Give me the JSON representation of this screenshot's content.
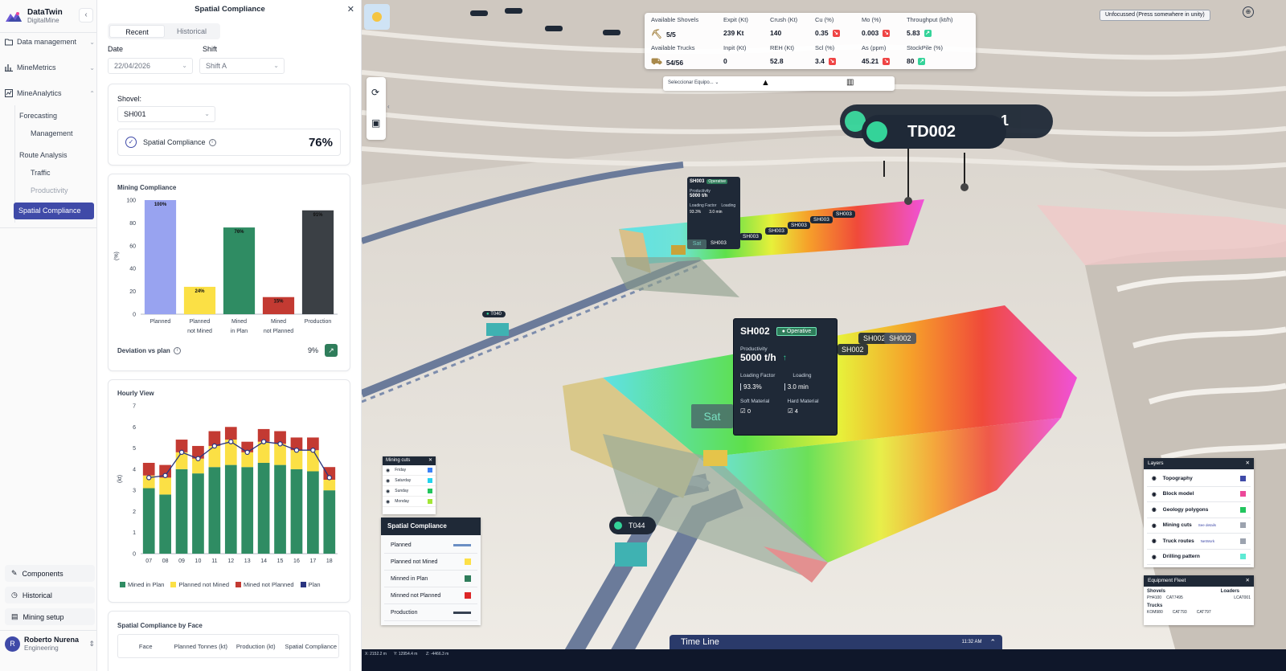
{
  "brand": {
    "name": "DataTwin",
    "sub": "DigitalMine"
  },
  "sidebar": {
    "data_management": "Data management",
    "mine_metrics": "MineMetrics",
    "mine_analytics": "MineAnalytics",
    "forecasting": "Forecasting",
    "management": "Management",
    "route_analysis": "Route Analysis",
    "traffic": "Traffic",
    "productivity": "Productivity",
    "spatial_compliance": "Spatial Compliance",
    "components": "Components",
    "historical": "Historical",
    "mining_setup": "Mining setup",
    "user_initial": "R",
    "user_name": "Roberto Nurena",
    "user_role": "Engineering"
  },
  "panel": {
    "title": "Spatial Compliance",
    "tabs": [
      "Recent",
      "Historical"
    ],
    "date_label": "Date",
    "date_value": "22/04/2026",
    "shift_label": "Shift",
    "shift_value": "Shift A",
    "shovel_label": "Shovel:",
    "shovel_value": "SH001",
    "kpi_label": "Spatial Compliance",
    "kpi_value": "76%",
    "mining_compliance_title": "Mining Compliance",
    "deviation_label": "Deviation vs plan",
    "deviation_value": "9%",
    "hourly_title": "Hourly View",
    "by_face_title": "Spatial Compliance by Face",
    "table_headers": [
      "Face",
      "Planned Tonnes (kt)",
      "Production (kt)",
      "Spatial Compliance"
    ]
  },
  "chart_data": [
    {
      "type": "bar",
      "title": "Mining Compliance",
      "ylabel": "(%)",
      "ylim": [
        0,
        100
      ],
      "yticks": [
        0,
        20,
        40,
        60,
        80,
        100
      ],
      "categories": [
        "Planned",
        "Planned not Mined",
        "Mined in Plan",
        "Mined not Planned",
        "Production"
      ],
      "category_lines": [
        [
          "Planned"
        ],
        [
          "Planned",
          "not Mined"
        ],
        [
          "Mined",
          "in Plan"
        ],
        [
          "Mined",
          "not Planned"
        ],
        [
          "Production"
        ]
      ],
      "values": [
        100,
        24,
        76,
        15,
        91
      ],
      "labels": [
        "100%",
        "24%",
        "76%",
        "15%",
        "91%"
      ],
      "colors": [
        "#98a3f0",
        "#fbe045",
        "#2f8c63",
        "#c33a32",
        "#3b4045"
      ]
    },
    {
      "type": "bar",
      "title": "Hourly View",
      "ylabel": "(kt)",
      "ylim": [
        0,
        7
      ],
      "yticks": [
        0,
        1,
        2,
        3,
        4,
        5,
        6,
        7
      ],
      "categories": [
        "07",
        "08",
        "09",
        "10",
        "11",
        "12",
        "13",
        "14",
        "15",
        "16",
        "17",
        "18"
      ],
      "series": [
        {
          "name": "Mined in Plan",
          "type": "bar",
          "color": "#2f8c63",
          "values": [
            3.1,
            2.8,
            4.0,
            3.8,
            4.1,
            4.2,
            4.1,
            4.3,
            4.2,
            4.0,
            3.9,
            3.0
          ]
        },
        {
          "name": "Planned not Mined",
          "type": "bar",
          "color": "#fbe045",
          "values": [
            0.6,
            0.8,
            0.8,
            0.7,
            1.0,
            1.2,
            0.7,
            1.0,
            1.0,
            0.9,
            1.0,
            0.5
          ]
        },
        {
          "name": "Mined not Planned",
          "type": "bar",
          "color": "#c33a32",
          "values": [
            0.6,
            0.6,
            0.6,
            0.6,
            0.7,
            0.6,
            0.5,
            0.6,
            0.6,
            0.6,
            0.6,
            0.6
          ]
        },
        {
          "name": "Plan",
          "type": "line",
          "color": "#2a3580",
          "values": [
            3.6,
            3.7,
            4.8,
            4.5,
            5.1,
            5.3,
            4.8,
            5.3,
            5.2,
            4.9,
            4.9,
            3.6
          ]
        }
      ]
    }
  ],
  "metrics": [
    {
      "label": "Available Shovels",
      "value": "5/5",
      "icon": "shovel-icon"
    },
    {
      "label": "Expit (Kt)",
      "value": "239 Kt"
    },
    {
      "label": "Crush (Kt)",
      "value": "140"
    },
    {
      "label": "Cu (%)",
      "value": "0.35",
      "trend": "down"
    },
    {
      "label": "Mo (%)",
      "value": "0.003",
      "trend": "down"
    },
    {
      "label": "Throughput (kt/h)",
      "value": "5.83",
      "trend": "up"
    },
    {
      "label": "Available Trucks",
      "value": "54/56",
      "icon": "truck-icon"
    },
    {
      "label": "Inpit (Kt)",
      "value": "0"
    },
    {
      "label": "REH (Kt)",
      "value": "52.8"
    },
    {
      "label": "Scl (%)",
      "value": "3.4",
      "trend": "down"
    },
    {
      "label": "As (ppm)",
      "value": "45.21",
      "trend": "down"
    },
    {
      "label": "StockPile (%)",
      "value": "80",
      "trend": "up"
    }
  ],
  "scene": {
    "equip_select": "Seleccionar Equipo...",
    "unfocused": "Unfocussed (Press somewhere in unity)",
    "td_tag": "TD002",
    "td_tag_partial": "1",
    "sh002_popup": {
      "id": "SH002",
      "status": "Operative",
      "productivity_label": "Productivity",
      "productivity": "5000 t/h",
      "loading_factor_label": "Loading Factor",
      "loading_factor": "93.3%",
      "loading_label": "Loading",
      "loading": "3.0 min",
      "soft_label": "Soft Material",
      "soft_value": "0",
      "hard_label": "Hard Material",
      "hard_value": "4"
    },
    "sh003_popup": {
      "id": "SH003",
      "status": "Operative",
      "productivity_label": "Productivity",
      "productivity": "5000 t/h",
      "loading_factor_label": "Loading Factor",
      "loading_factor": "93.3%",
      "loading_label": "Loading",
      "loading": "3.0 min"
    },
    "face_label_sh002": "SH002",
    "face_label_sh003": "SH003",
    "sat_label": "Sat",
    "truck_t040": "T040",
    "truck_t044": "T044",
    "mining_cuts": {
      "title": "Mining cuts",
      "days": [
        "Friday",
        "Saturday",
        "Sunday",
        "Monday"
      ]
    },
    "legend": {
      "title": "Spatial Compliance",
      "items": [
        {
          "label": "Planned",
          "color": "#6b8fc4"
        },
        {
          "label": "Planned not Mined",
          "color": "#fde047"
        },
        {
          "label": "Minned in Plan",
          "color": "#2f7d5b"
        },
        {
          "label": "Minned not Planned",
          "color": "#dc2626"
        },
        {
          "label": "Production",
          "color": "#374151"
        }
      ]
    },
    "layers": {
      "title": "Layers",
      "items": [
        {
          "label": "Topography",
          "color": "#3f4aa8",
          "note": ""
        },
        {
          "label": "Block model",
          "color": "#ec4899",
          "note": ""
        },
        {
          "label": "Geology polygons",
          "color": "#22c55e",
          "note": ""
        },
        {
          "label": "Mining cuts",
          "color": "#9ca3af",
          "note": "See details"
        },
        {
          "label": "Truck routes",
          "color": "#9ca3af",
          "note": "NetWork"
        },
        {
          "label": "Drilling pattern",
          "color": "#5eead4",
          "note": ""
        }
      ]
    },
    "fleet": {
      "title": "Equipment Fleet",
      "shovels_label": "Shovels",
      "loaders_label": "Loaders",
      "trucks_label": "Trucks",
      "shovel_1": "PH4100",
      "shovel_2": "CAT7495",
      "loader_1": "LCAT001",
      "truck_1": "KOM980",
      "truck_2": "CAT793",
      "truck_3": "CAT797"
    },
    "timeline": {
      "label": "Time Line",
      "time": "11:32 AM"
    },
    "coords": [
      "X: 2152.2 m",
      "Y: 12954.4 m",
      "Z: -4466.3 m"
    ]
  }
}
